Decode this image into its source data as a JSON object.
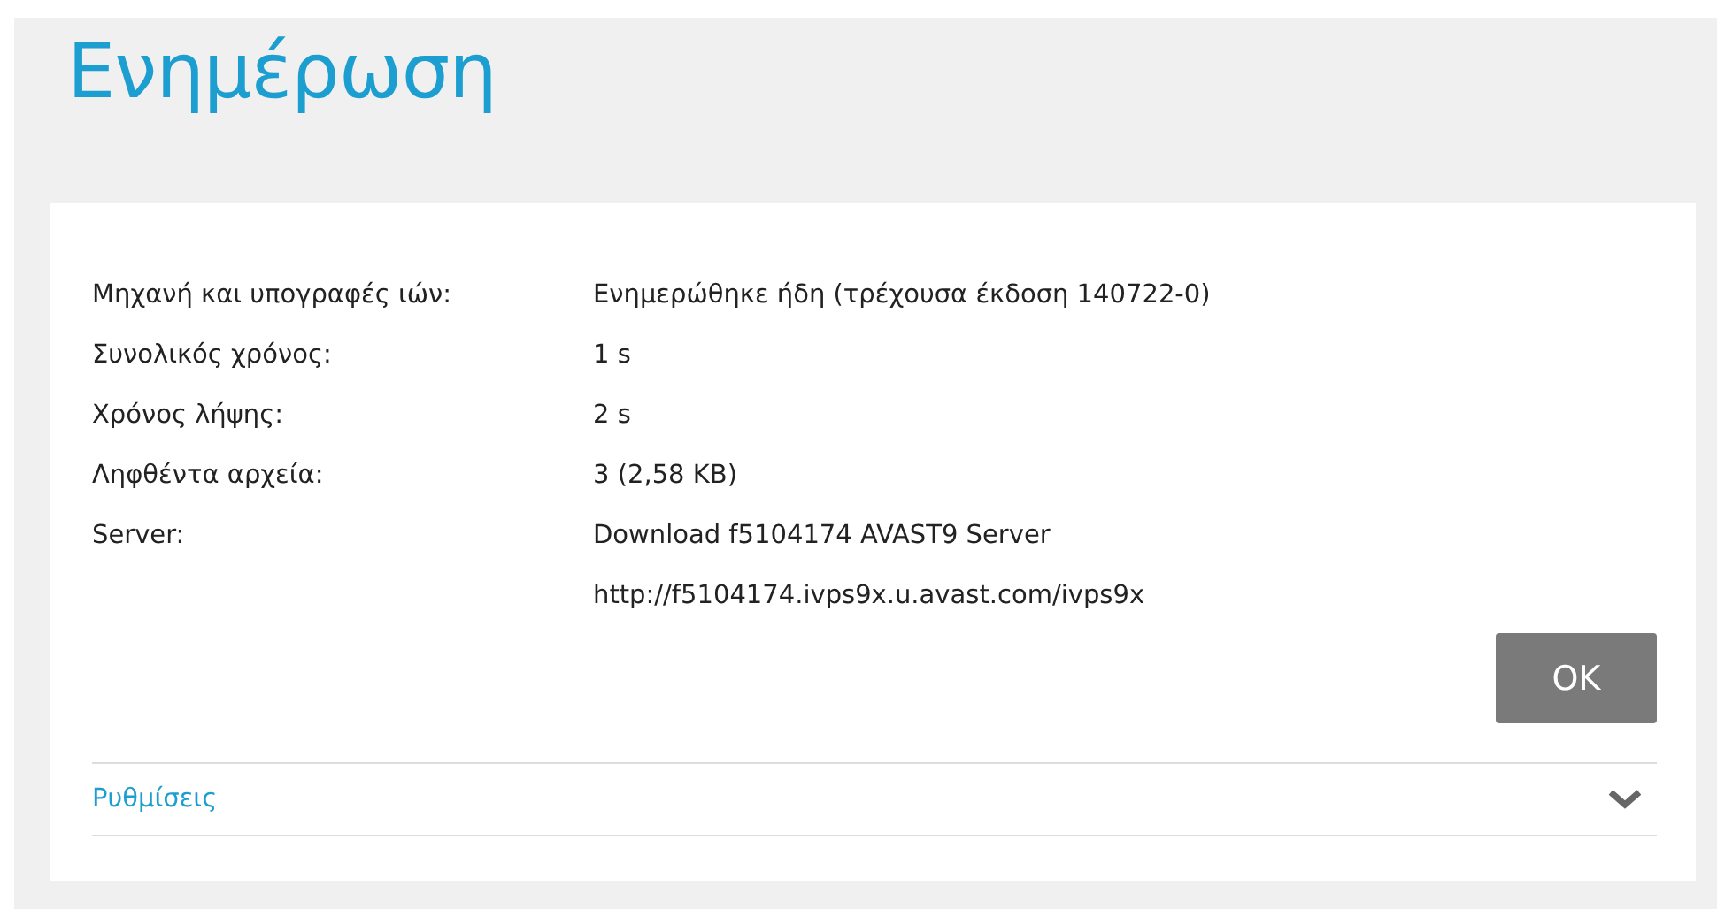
{
  "title": "Ενημέρωση",
  "details": [
    {
      "label": "Μηχανή και υπογραφές ιών:",
      "values": [
        "Ενημερώθηκε ήδη (τρέχουσα έκδοση 140722-0)"
      ]
    },
    {
      "label": "Συνολικός χρόνος:",
      "values": [
        "1 s"
      ]
    },
    {
      "label": "Χρόνος λήψης:",
      "values": [
        "2 s"
      ]
    },
    {
      "label": "Ληφθέντα αρχεία:",
      "values": [
        "3 (2,58 KB)"
      ]
    },
    {
      "label": "Server:",
      "values": [
        "Download f5104174 AVAST9 Server",
        "http://f5104174.ivps9x.u.avast.com/ivps9x"
      ]
    }
  ],
  "ok_button": "OK",
  "settings": {
    "label": "Ρυθμίσεις",
    "expanded": false
  }
}
